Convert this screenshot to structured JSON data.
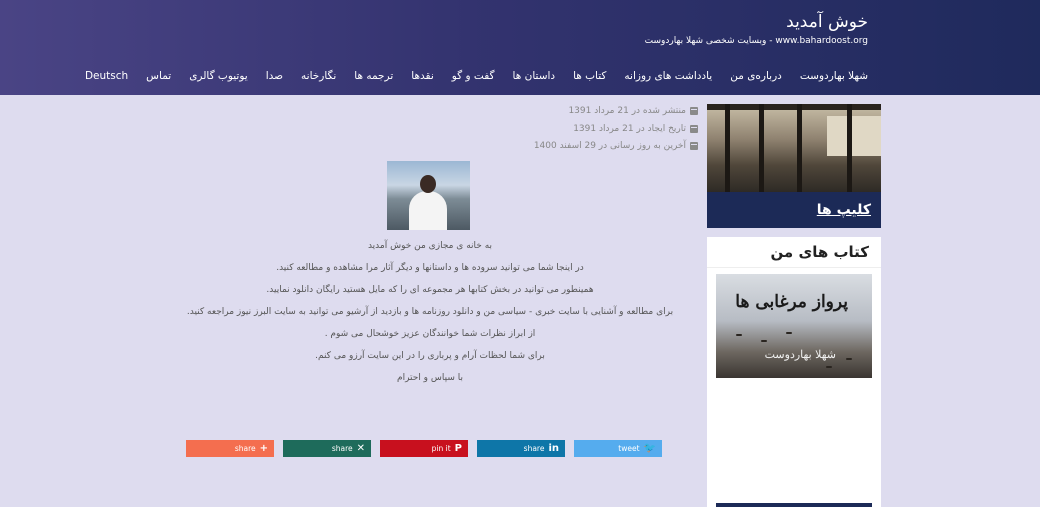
{
  "header": {
    "title": "خوش آمدید",
    "subtitle": "www.bahardoost.org - وبسایت شخصی شهلا بهاردوست",
    "nav": [
      "شهلا بهاردوست",
      "درباره‌ی من",
      "یادداشت های روزانه",
      "کتاب ها",
      "داستان ها",
      "گفت و گو",
      "نقدها",
      "ترجمه ها",
      "نگارخانه",
      "صدا",
      "یوتیوب گالری",
      "تماس",
      "Deutsch"
    ]
  },
  "article": {
    "published": "منتشر شده در 21 مرداد 1391",
    "created": "تاریخ ایجاد در 21 مرداد 1391",
    "updated": "آخرین به روز رسانی در 29 اسفند 1400",
    "lines": [
      "به خانه ی مجازی من خوش آمدید",
      "در اینجا شما می توانید سروده ها و داستانها و دیگر آثار مرا مشاهده و مطالعه کنید.",
      "همینطور می توانید در بخش کتابها هر مجموعه ای را که مایل هستید رایگان دانلود نمایید.",
      "برای مطالعه و آشنایی با سایت خبری - سیاسی من و دانلود روزنامه ها و بازدید از آرشیو می توانید به سایت البرز نیوز مراجعه کنید.",
      "از ابراز نظرات شما خوانندگان عزیز خوشحال می شوم .",
      "برای شما لحظات آرام و پرباری را در این سایت آرزو می کنم.",
      "با سپاس و احترام"
    ]
  },
  "share": {
    "twitter": "tweet",
    "linkedin": "share",
    "pinterest": "pin it",
    "xing": "share",
    "addthis": "share"
  },
  "sidebar": {
    "clips_title": "کلیپ ها",
    "books_title": "کتاب های من",
    "book_cover_title": "پرواز مرغابی ها",
    "book_cover_author": "شهلا بهاردوست"
  }
}
